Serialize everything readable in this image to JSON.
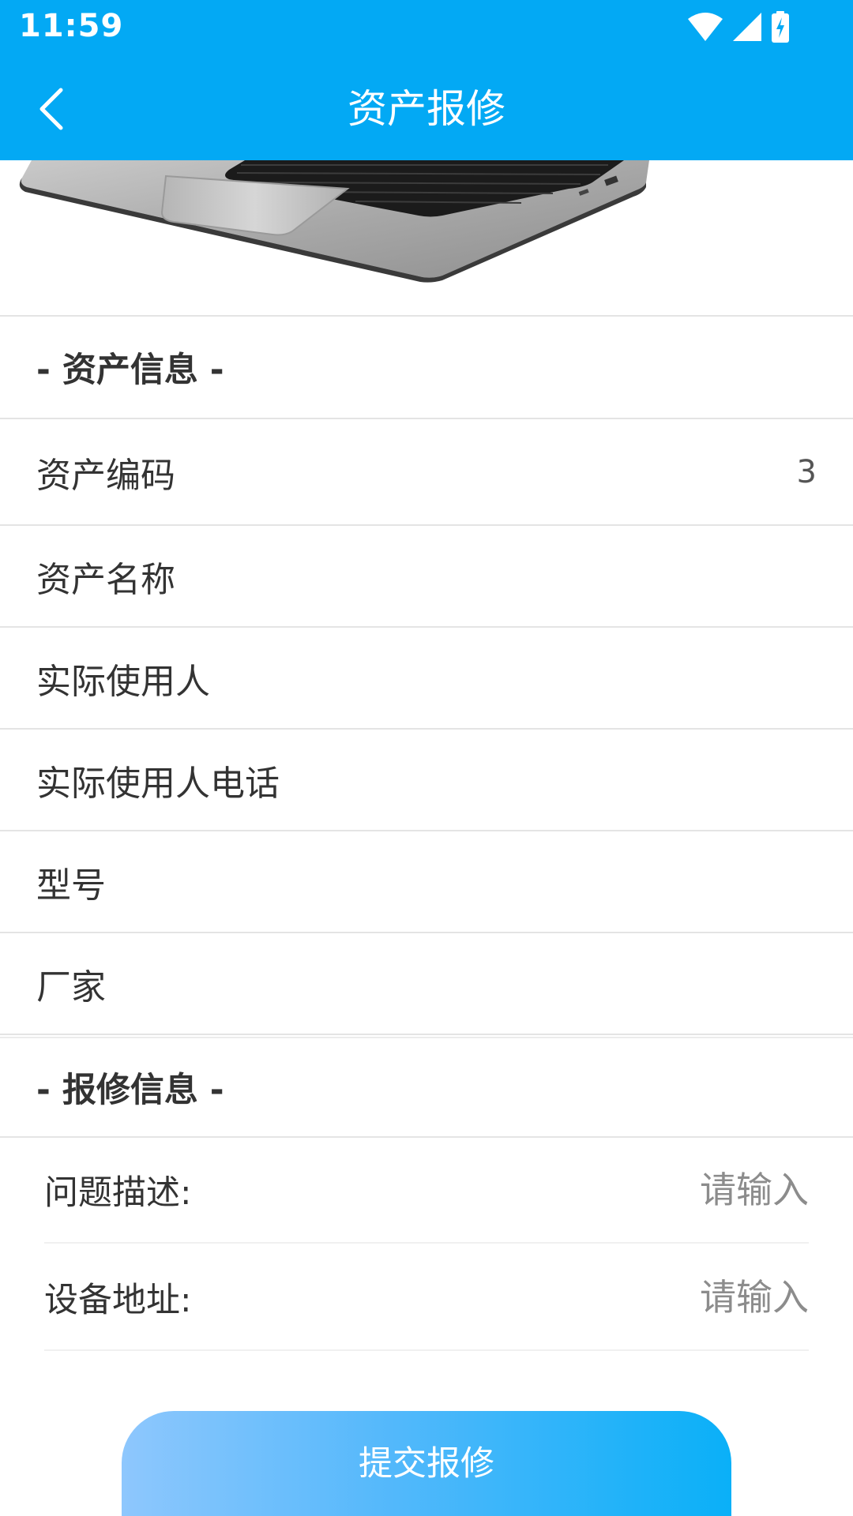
{
  "status_bar": {
    "time": "11:59"
  },
  "header": {
    "title": "资产报修",
    "back_icon": "chevron-left-icon"
  },
  "colors": {
    "primary": "#03a9f4",
    "button_gradient_start": "#8ec7fd",
    "button_gradient_end": "#0ab0f8"
  },
  "asset_info": {
    "section_title": "- 资产信息 -",
    "fields": [
      {
        "label": "资产编码",
        "value": "3"
      },
      {
        "label": "资产名称",
        "value": ""
      },
      {
        "label": "实际使用人",
        "value": ""
      },
      {
        "label": "实际使用人电话",
        "value": ""
      },
      {
        "label": "型号",
        "value": ""
      },
      {
        "label": "厂家",
        "value": ""
      }
    ]
  },
  "repair_info": {
    "section_title": "- 报修信息 -",
    "problem_label": "问题描述:",
    "problem_placeholder": "请输入",
    "problem_value": "",
    "address_label": "设备地址:",
    "address_placeholder": "请输入",
    "address_value": ""
  },
  "submit_button": {
    "label": "提交报修"
  }
}
